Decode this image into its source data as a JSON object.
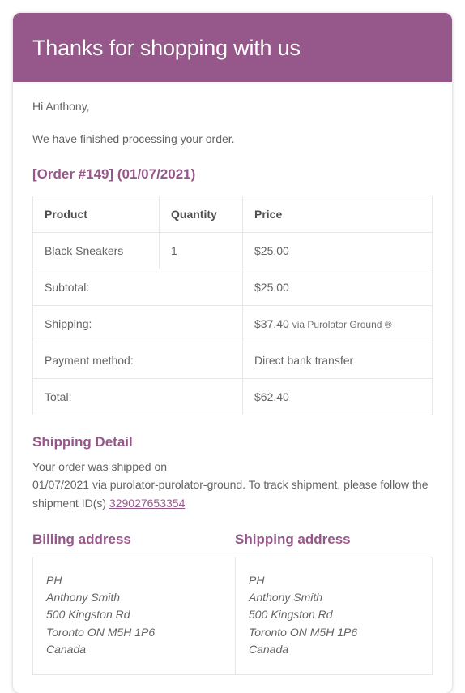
{
  "header": {
    "title": "Thanks for shopping with us"
  },
  "body": {
    "greeting": "Hi Anthony,",
    "intro": "We have finished processing your order.",
    "order_heading": "[Order #149] (01/07/2021)"
  },
  "order_table": {
    "columns": [
      "Product",
      "Quantity",
      "Price"
    ],
    "items": [
      {
        "product": "Black Sneakers",
        "quantity": "1",
        "price": "$25.00"
      }
    ],
    "summary": [
      {
        "label": "Subtotal:",
        "value": "$25.00"
      },
      {
        "label": "Shipping:",
        "value": "$37.40",
        "note": "via Purolator Ground ®"
      },
      {
        "label": "Payment method:",
        "value": "Direct bank transfer"
      },
      {
        "label": "Total:",
        "value": "$62.40"
      }
    ]
  },
  "shipping_detail": {
    "heading": "Shipping Detail",
    "line1": "Your order was shipped on",
    "line2": "01/07/2021 via purolator-purolator-ground. To track shipment, please follow the shipment ID(s)",
    "tracking_id": "329027653354"
  },
  "addresses": {
    "billing_heading": "Billing address",
    "shipping_heading": "Shipping address",
    "billing": {
      "line1": "PH",
      "line2": "Anthony Smith",
      "line3": "500 Kingston Rd",
      "line4": "Toronto ON M5H 1P6",
      "line5": "Canada"
    },
    "shipping": {
      "line1": "PH",
      "line2": "Anthony Smith",
      "line3": "500 Kingston Rd",
      "line4": "Toronto ON M5H 1P6",
      "line5": "Canada"
    }
  },
  "colors": {
    "brand_purple": "#96588a",
    "body_text": "#636363",
    "border": "#e6e6e6"
  }
}
